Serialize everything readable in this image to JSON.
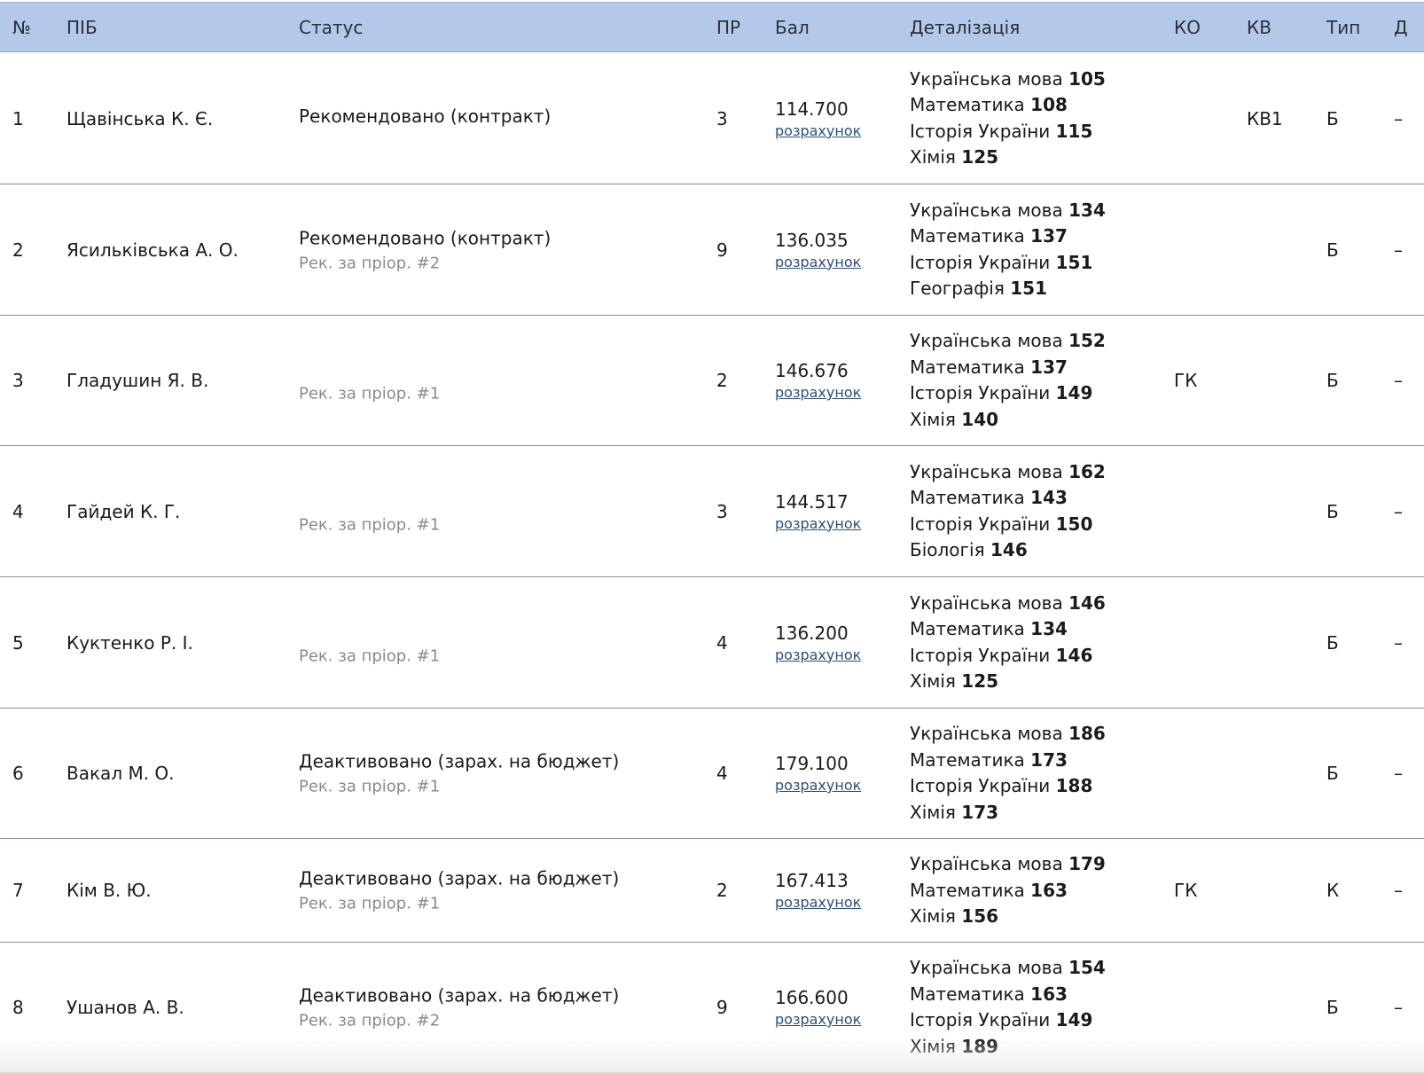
{
  "headers": {
    "num": "№",
    "name": "ПІБ",
    "status": "Статус",
    "priority": "ПР",
    "score": "Бал",
    "details": "Деталізація",
    "ko": "КО",
    "kv": "КВ",
    "type": "Тип",
    "d": "Д"
  },
  "rows": [
    {
      "num": "1",
      "name": "Щавінська К. Є.",
      "status": "Рекомендовано (контракт)",
      "status_sub": "",
      "priority": "3",
      "score": "114.700",
      "calc_label": "розрахунок",
      "details": [
        {
          "subject": "Українська мова",
          "score": "105"
        },
        {
          "subject": "Математика",
          "score": "108"
        },
        {
          "subject": "Історія України",
          "score": "115"
        },
        {
          "subject": "Хімія",
          "score": "125"
        }
      ],
      "ko": "",
      "kv": "КВ1",
      "type": "Б",
      "d": "–"
    },
    {
      "num": "2",
      "name": "Ясильківська А. О.",
      "status": "Рекомендовано (контракт)",
      "status_sub": "Рек. за пріор. #2",
      "priority": "9",
      "score": "136.035",
      "calc_label": "розрахунок",
      "details": [
        {
          "subject": "Українська мова",
          "score": "134"
        },
        {
          "subject": "Математика",
          "score": "137"
        },
        {
          "subject": "Історія України",
          "score": "151"
        },
        {
          "subject": "Географія",
          "score": "151"
        }
      ],
      "ko": "",
      "kv": "",
      "type": "Б",
      "d": "–"
    },
    {
      "num": "3",
      "name": "Гладушин Я. В.",
      "status": "",
      "status_sub": "Рек. за пріор. #1",
      "priority": "2",
      "score": "146.676",
      "calc_label": "розрахунок",
      "details": [
        {
          "subject": "Українська мова",
          "score": "152"
        },
        {
          "subject": "Математика",
          "score": "137"
        },
        {
          "subject": "Історія України",
          "score": "149"
        },
        {
          "subject": "Хімія",
          "score": "140"
        }
      ],
      "ko": "ГК",
      "kv": "",
      "type": "Б",
      "d": "–"
    },
    {
      "num": "4",
      "name": "Гайдей К. Г.",
      "status": "",
      "status_sub": "Рек. за пріор. #1",
      "priority": "3",
      "score": "144.517",
      "calc_label": "розрахунок",
      "details": [
        {
          "subject": "Українська мова",
          "score": "162"
        },
        {
          "subject": "Математика",
          "score": "143"
        },
        {
          "subject": "Історія України",
          "score": "150"
        },
        {
          "subject": "Біологія",
          "score": "146"
        }
      ],
      "ko": "",
      "kv": "",
      "type": "Б",
      "d": "–"
    },
    {
      "num": "5",
      "name": "Куктенко Р. І.",
      "status": "",
      "status_sub": "Рек. за пріор. #1",
      "priority": "4",
      "score": "136.200",
      "calc_label": "розрахунок",
      "details": [
        {
          "subject": "Українська мова",
          "score": "146"
        },
        {
          "subject": "Математика",
          "score": "134"
        },
        {
          "subject": "Історія України",
          "score": "146"
        },
        {
          "subject": "Хімія",
          "score": "125"
        }
      ],
      "ko": "",
      "kv": "",
      "type": "Б",
      "d": "–"
    },
    {
      "num": "6",
      "name": "Вакал М. О.",
      "status": "Деактивовано (зарах. на бюджет)",
      "status_sub": "Рек. за пріор. #1",
      "priority": "4",
      "score": "179.100",
      "calc_label": "розрахунок",
      "details": [
        {
          "subject": "Українська мова",
          "score": "186"
        },
        {
          "subject": "Математика",
          "score": "173"
        },
        {
          "subject": "Історія України",
          "score": "188"
        },
        {
          "subject": "Хімія",
          "score": "173"
        }
      ],
      "ko": "",
      "kv": "",
      "type": "Б",
      "d": "–"
    },
    {
      "num": "7",
      "name": "Кім В. Ю.",
      "status": "Деактивовано (зарах. на бюджет)",
      "status_sub": "Рек. за пріор. #1",
      "priority": "2",
      "score": "167.413",
      "calc_label": "розрахунок",
      "details": [
        {
          "subject": "Українська мова",
          "score": "179"
        },
        {
          "subject": "Математика",
          "score": "163"
        },
        {
          "subject": "Хімія",
          "score": "156"
        }
      ],
      "ko": "ГК",
      "kv": "",
      "type": "К",
      "d": "–"
    },
    {
      "num": "8",
      "name": "Ушанов А. В.",
      "status": "Деактивовано (зарах. на бюджет)",
      "status_sub": "Рек. за пріор. #2",
      "priority": "9",
      "score": "166.600",
      "calc_label": "розрахунок",
      "details": [
        {
          "subject": "Українська мова",
          "score": "154"
        },
        {
          "subject": "Математика",
          "score": "163"
        },
        {
          "subject": "Історія України",
          "score": "149"
        },
        {
          "subject": "Хімія",
          "score": "189"
        }
      ],
      "ko": "",
      "kv": "",
      "type": "Б",
      "d": "–"
    }
  ]
}
